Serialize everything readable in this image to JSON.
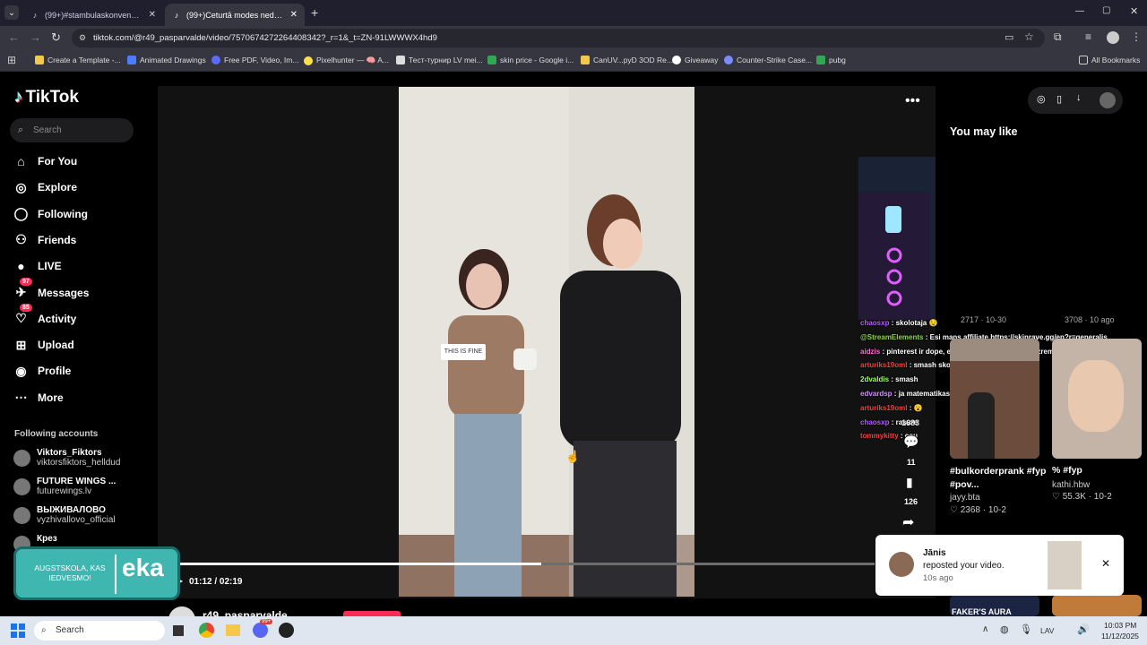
{
  "tabs": [
    {
      "label": "(99+)#stambulaskonvencija | Ti"
    },
    {
      "label": "(99+)Ceturtā modes nedēļas di"
    }
  ],
  "address": {
    "url": "tiktok.com/@r49_pasparvalde/video/7570674272264408342?_r=1&_t=ZN-91LWWWX4hd9"
  },
  "bookmarks": [
    {
      "label": "Create a Template -..."
    },
    {
      "label": "Animated Drawings"
    },
    {
      "label": "Free PDF, Video, Im..."
    },
    {
      "label": "Pixelhunter — 🧠 A..."
    },
    {
      "label": "Тест-турнир LV mei..."
    },
    {
      "label": "skin price - Google i..."
    },
    {
      "label": "CanUV...pyD 3OD Re..."
    },
    {
      "label": "Giveaway"
    },
    {
      "label": "Counter-Strike Case..."
    },
    {
      "label": "pubg"
    }
  ],
  "bookmarks_all": "All Bookmarks",
  "logo": "TikTok",
  "search": {
    "placeholder": "Search"
  },
  "nav": [
    {
      "label": "For You",
      "icon": "home-icon"
    },
    {
      "label": "Explore",
      "icon": "compass-icon"
    },
    {
      "label": "Following",
      "icon": "following-icon"
    },
    {
      "label": "Friends",
      "icon": "friends-icon"
    },
    {
      "label": "LIVE",
      "icon": "live-icon"
    },
    {
      "label": "Messages",
      "icon": "messages-icon",
      "badge": "97"
    },
    {
      "label": "Activity",
      "icon": "activity-icon",
      "badge": "85"
    },
    {
      "label": "Upload",
      "icon": "upload-icon"
    },
    {
      "label": "Profile",
      "icon": "profile-icon"
    },
    {
      "label": "More",
      "icon": "more-icon"
    }
  ],
  "following_title": "Following accounts",
  "following": [
    {
      "name": "Viktors_Fiktors",
      "handle": "viktorsfiktors_helldud"
    },
    {
      "name": "FUTURE WINGS ...",
      "handle": "futurewings.lv"
    },
    {
      "name": "ВЫЖИВАЛОВО",
      "handle": "vyzhivallovo_official"
    },
    {
      "name": "Крез",
      "handle": ""
    }
  ],
  "overlay_banner": {
    "text": "AUGSTSKOLA, KAS IEDVESMO!",
    "brand": "eka"
  },
  "video": {
    "sign_text": "THIS IS FINE",
    "time": "01:12 / 02:19",
    "progress": 0.52,
    "author": "r49_pasparvalde"
  },
  "actions": {
    "comments": "11",
    "saves": "126",
    "likes": "1683"
  },
  "you_may_like": "You may like",
  "stream_chat": [
    {
      "user": "chaosxp",
      "msg": " : skolotaja 🤤",
      "color": "#b05cff"
    },
    {
      "user": "@StreamElements",
      "msg": " : Esi mans affiliate https://skinrave.gg/en?r=generalis",
      "color": "#8cd14b"
    },
    {
      "user": "aidzis",
      "msg": " : pinterest ir dope, es saviz dzivokli pec vina izremonteju",
      "color": "#ff6bd8"
    },
    {
      "user": "arturiks19oml",
      "msg": " : smash skolotaju",
      "color": "#ff3b3b"
    },
    {
      "user": "2dvaldis",
      "msg": " : smash",
      "color": "#9cff5e"
    },
    {
      "user": "edvardsp",
      "msg": " : ja matematikas",
      "color": "#cf8cff"
    },
    {
      "user": "arturiks19oml",
      "msg": " : 😮",
      "color": "#ff3b3b"
    },
    {
      "user": "chaosxp",
      "msg": " : rasure",
      "color": "#b05cff"
    },
    {
      "user": "tommykitty",
      "msg": " : cou",
      "color": "#ff3b3b"
    }
  ],
  "cards": [
    {
      "title": "#bulkorderprank #fyp #pov...",
      "author": "jayy.bta",
      "likes": "2368",
      "date": "10-2"
    },
    {
      "title": "% #fyp",
      "author": "kathi.hbw",
      "likes": "55.3K",
      "date": "10-2"
    }
  ],
  "partial_stats": [
    {
      "text": "2717 · 10-30"
    },
    {
      "text": "3708 · 10 ago"
    }
  ],
  "bottom_card": {
    "text": "FAKER'S AURA"
  },
  "notification": {
    "name": "Jānis",
    "text": "reposted your video.",
    "time": "10s ago"
  },
  "taskbar": {
    "search": "Search",
    "lang": "LAV",
    "time": "10:03 PM",
    "date": "11/12/2025",
    "badge": "99+"
  }
}
